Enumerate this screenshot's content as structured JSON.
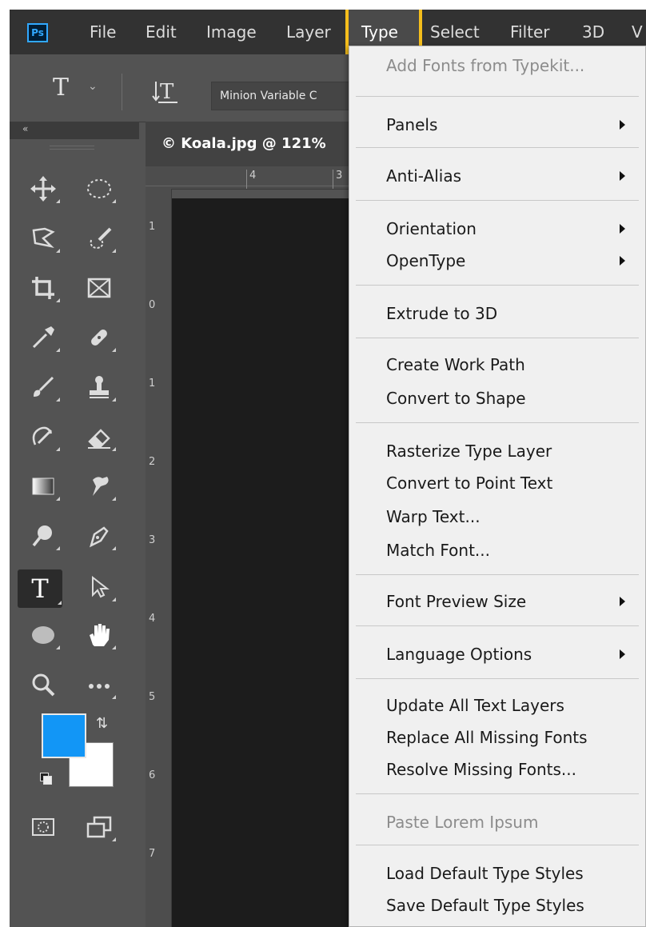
{
  "app": {
    "logo_text": "Ps"
  },
  "menubar": {
    "items": [
      "File",
      "Edit",
      "Image",
      "Layer",
      "Type",
      "Select",
      "Filter",
      "3D",
      "V"
    ],
    "active": "Type",
    "highlight_color": "#f5be1c"
  },
  "options_bar": {
    "tool_glyph": "T",
    "font_family_value": "Minion Variable C"
  },
  "document": {
    "tab_title": "© Koala.jpg @ 121%",
    "ruler_top_numbers": [
      "4",
      "3"
    ],
    "ruler_left_numbers": [
      "1",
      "0",
      "1",
      "2",
      "3",
      "4",
      "5",
      "6",
      "7"
    ]
  },
  "colors": {
    "foreground": "#1296f6",
    "background": "#ffffff",
    "accent": "#31a8ff"
  },
  "toolbar": {
    "tools": [
      "move-icon",
      "ellipse-marquee-icon",
      "lasso-icon",
      "quick-selection-icon",
      "crop-icon",
      "frame-icon",
      "eyedropper-icon",
      "healing-brush-icon",
      "brush-icon",
      "stamp-icon",
      "history-brush-icon",
      "eraser-icon",
      "gradient-icon",
      "smudge-icon",
      "dodge-icon",
      "pen-icon",
      "type-icon",
      "path-selection-icon",
      "ellipse-shape-icon",
      "hand-icon",
      "zoom-icon",
      "more-tools-icon",
      "quick-mask-icon",
      "screen-mode-icon"
    ],
    "active_tool": "type-icon"
  },
  "type_menu": {
    "items": [
      {
        "label": "Add Fonts from Typekit...",
        "enabled": false,
        "submenu": false
      },
      {
        "label": "Panels",
        "enabled": true,
        "submenu": true
      },
      {
        "label": "Anti-Alias",
        "enabled": true,
        "submenu": true
      },
      {
        "label": "Orientation",
        "enabled": true,
        "submenu": true
      },
      {
        "label": "OpenType",
        "enabled": true,
        "submenu": true
      },
      {
        "label": "Extrude to 3D",
        "enabled": true,
        "submenu": false
      },
      {
        "label": "Create Work Path",
        "enabled": true,
        "submenu": false
      },
      {
        "label": "Convert to Shape",
        "enabled": true,
        "submenu": false
      },
      {
        "label": "Rasterize Type Layer",
        "enabled": true,
        "submenu": false
      },
      {
        "label": "Convert to Point Text",
        "enabled": true,
        "submenu": false
      },
      {
        "label": "Warp Text...",
        "enabled": true,
        "submenu": false
      },
      {
        "label": "Match Font...",
        "enabled": true,
        "submenu": false
      },
      {
        "label": "Font Preview Size",
        "enabled": true,
        "submenu": true
      },
      {
        "label": "Language Options",
        "enabled": true,
        "submenu": true
      },
      {
        "label": "Update All Text Layers",
        "enabled": true,
        "submenu": false
      },
      {
        "label": "Replace All Missing Fonts",
        "enabled": true,
        "submenu": false
      },
      {
        "label": "Resolve Missing Fonts...",
        "enabled": true,
        "submenu": false
      },
      {
        "label": "Paste Lorem Ipsum",
        "enabled": false,
        "submenu": false
      },
      {
        "label": "Load Default Type Styles",
        "enabled": true,
        "submenu": false
      },
      {
        "label": "Save Default Type Styles",
        "enabled": true,
        "submenu": false
      }
    ]
  }
}
